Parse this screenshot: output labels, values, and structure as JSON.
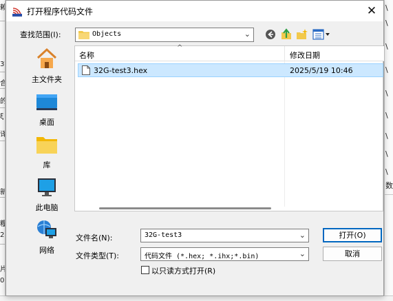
{
  "background": {
    "left_fragments": [
      "赖",
      "3W",
      "合",
      "的",
      "ξ",
      "译",
      "新",
      "糧",
      "2",
      "片",
      "0"
    ],
    "right_fragments": [
      "\\",
      "\\",
      "\\",
      "\\",
      "\\",
      "\\",
      "\\",
      "\\",
      "\\",
      "数"
    ]
  },
  "dialog": {
    "title": "打开程序代码文件",
    "close_glyph": "✕",
    "look_in_label": "查找范围(I):",
    "look_in_value": "Objects",
    "toolbar": {
      "back_icon": "back-arrow-icon",
      "up_icon": "up-folder-icon",
      "new_folder_icon": "new-folder-icon",
      "view_icon": "view-menu-icon"
    },
    "places": [
      {
        "label": "主文件夹",
        "icon": "home-icon"
      },
      {
        "label": "桌面",
        "icon": "desktop-icon"
      },
      {
        "label": "库",
        "icon": "library-folder-icon"
      },
      {
        "label": "此电脑",
        "icon": "computer-icon"
      },
      {
        "label": "网络",
        "icon": "network-icon"
      }
    ],
    "file_list": {
      "col_name": "名称",
      "col_date": "修改日期",
      "sort_glyph": "^",
      "files": [
        {
          "name": "32G-test3.hex",
          "date": "2025/5/19 10:46",
          "selected": true
        }
      ]
    },
    "filename_label": "文件名(N):",
    "filename_value": "32G-test3",
    "filetype_label": "文件类型(T):",
    "filetype_value": "代码文件 (*.hex;  *.ihx;*.bin)",
    "open_button": "打开(O)",
    "cancel_button": "取消",
    "readonly_label": "以只读方式打开(R)",
    "readonly_checked": false
  },
  "colors": {
    "selection_bg": "#cce8ff",
    "selection_border": "#99d1ff",
    "default_button_border": "#0067c0"
  }
}
